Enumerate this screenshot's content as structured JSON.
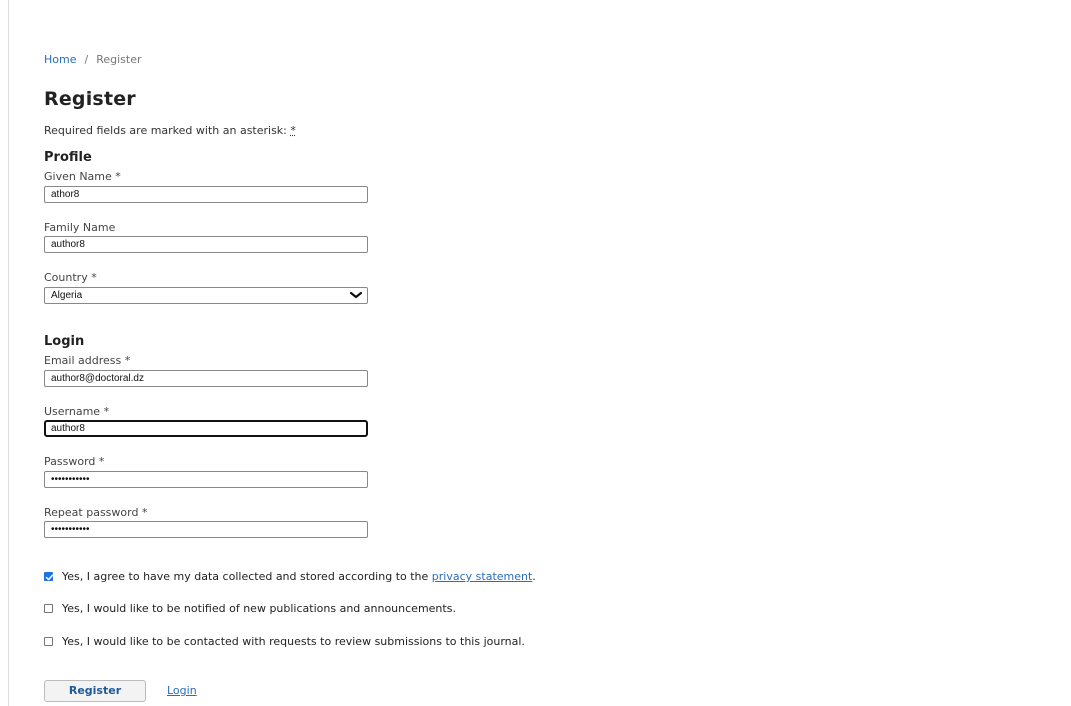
{
  "breadcrumb": {
    "home": "Home",
    "separator": "/",
    "current": "Register"
  },
  "page": {
    "title": "Register",
    "required_note": "Required fields are marked with an asterisk:",
    "required_marker": "*"
  },
  "profile": {
    "heading": "Profile",
    "given_name_label": "Given Name *",
    "given_name_value": "athor8",
    "family_name_label": "Family Name",
    "family_name_value": "author8",
    "country_label": "Country *",
    "country_value": "Algeria"
  },
  "login": {
    "heading": "Login",
    "email_label": "Email address *",
    "email_value": "author8@doctoral.dz",
    "username_label": "Username *",
    "username_value": "author8",
    "password_label": "Password *",
    "password_value": "•••••••••••",
    "repeat_password_label": "Repeat password *",
    "repeat_password_value": "•••••••••••"
  },
  "consents": {
    "privacy_text": "Yes, I agree to have my data collected and stored according to the",
    "privacy_link": "privacy statement",
    "privacy_end": ".",
    "privacy_checked": true,
    "notify_text": "Yes, I would like to be notified of new publications and announcements.",
    "notify_checked": false,
    "review_text": "Yes, I would like to be contacted with requests to review submissions to this journal.",
    "review_checked": false
  },
  "actions": {
    "register_label": "Register",
    "login_label": "Login"
  },
  "colors": {
    "link": "#2a6eb8",
    "checkbox_accent": "#1a73e8",
    "button_text": "#1e5a96"
  }
}
